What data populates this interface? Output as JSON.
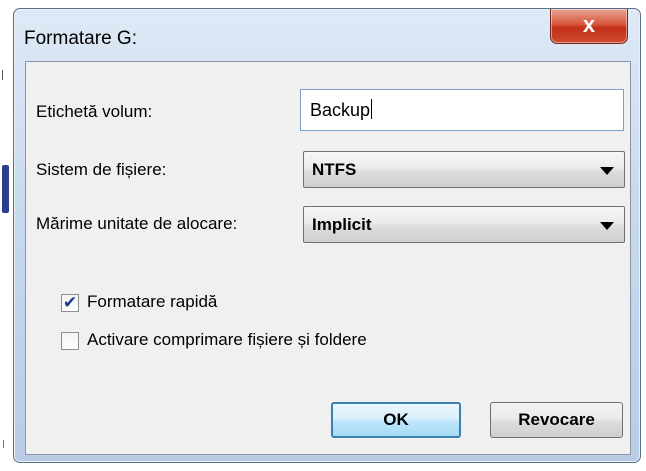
{
  "dialog": {
    "title": "Formatare G:",
    "close_label": "x"
  },
  "form": {
    "volume_label": {
      "label": "Etichetă volum:",
      "value": "Backup"
    },
    "file_system": {
      "label": "Sistem de fișiere:",
      "selected": "NTFS"
    },
    "allocation_unit": {
      "label": "Mărime unitate de alocare:",
      "selected": "Implicit"
    },
    "quick_format": {
      "label": "Formatare rapidă",
      "checked": true,
      "check_glyph": "✔"
    },
    "compression": {
      "label": "Activare comprimare fișiere și foldere",
      "checked": false
    }
  },
  "buttons": {
    "ok": "OK",
    "cancel": "Revocare"
  }
}
